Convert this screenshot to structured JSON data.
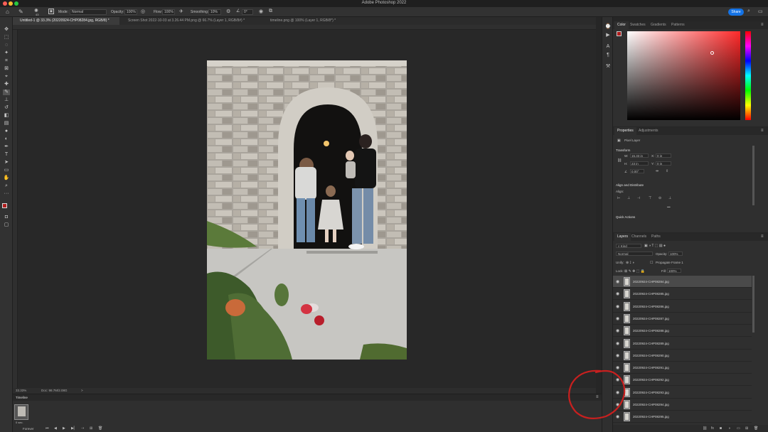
{
  "app": {
    "title": "Adobe Photoshop 2022"
  },
  "options_bar": {
    "mode_label": "Mode:",
    "mode_value": "Normal",
    "opacity_label": "Opacity:",
    "opacity_value": "100%",
    "flow_label": "Flow:",
    "flow_value": "100%",
    "smoothing_label": "Smoothing:",
    "smoothing_value": "10%",
    "angle_value": "0°",
    "brush_size": "43",
    "share_label": "Share"
  },
  "document_tabs": [
    {
      "label": "Untitled-1 @ 33.3% (20220924-CHP08284.jpg, RGB/8) *",
      "active": true
    },
    {
      "label": "Screen Shot 2022-10-03 at 3.26.44 PM.png @ 66.7% (Layer 1, RGB/8#) *",
      "active": false
    },
    {
      "label": "timeline.png @ 100% (Layer 1, RGB/8*) *",
      "active": false
    }
  ],
  "status": {
    "zoom": "33.33%",
    "doc": "Doc: 98.7M/2.08G",
    "arrow": ">"
  },
  "timeline": {
    "title": "Timeline",
    "frame_time": "0 sec.",
    "loop": "Forever"
  },
  "color_panel": {
    "tabs": [
      "Color",
      "Swatches",
      "Gradients",
      "Patterns"
    ],
    "active": "Color",
    "hue_color": "#ff2a2a"
  },
  "properties_panel": {
    "tabs": [
      "Properties",
      "Adjustments"
    ],
    "layer_type": "Pixel Layer",
    "transform_title": "Transform",
    "w_label": "W:",
    "w_value": "15.33 in",
    "h_label": "H:",
    "h_value": "23 in",
    "x_label": "X:",
    "x_value": "0 in",
    "y_label": "Y:",
    "y_value": "0 in",
    "angle_value": "0.00°",
    "align_title": "Align and Distribute",
    "align_label": "Align:",
    "more": "•••",
    "quick_actions_title": "Quick Actions"
  },
  "layers_panel": {
    "tabs": [
      "Layers",
      "Channels",
      "Paths"
    ],
    "filter_kind": "Kind",
    "blend_mode": "Normal",
    "opacity_label": "Opacity:",
    "opacity_value": "100%",
    "unify_label": "Unify:",
    "propagate_label": "Propagate Frame 1",
    "lock_label": "Lock:",
    "fill_label": "Fill:",
    "fill_value": "100%",
    "layers": [
      {
        "name": "20220924-CHP08284.jpg",
        "selected": true
      },
      {
        "name": "20220924-CHP08285.jpg",
        "selected": false
      },
      {
        "name": "20220924-CHP08286.jpg",
        "selected": false
      },
      {
        "name": "20220924-CHP08287.jpg",
        "selected": false
      },
      {
        "name": "20220924-CHP08288.jpg",
        "selected": false
      },
      {
        "name": "20220924-CHP08289.jpg",
        "selected": false
      },
      {
        "name": "20220924-CHP08290.jpg",
        "selected": false
      },
      {
        "name": "20220924-CHP08291.jpg",
        "selected": false
      },
      {
        "name": "20220924-CHP08292.jpg",
        "selected": false
      },
      {
        "name": "20220924-CHP08293.jpg",
        "selected": false
      },
      {
        "name": "20220924-CHP08294.jpg",
        "selected": false
      },
      {
        "name": "20220924-CHP08295.jpg",
        "selected": false
      }
    ]
  },
  "colors": {
    "accent": "#1473e6",
    "foreground": "#b01e1e",
    "background": "#ffffff",
    "annotation": "#c8201f"
  }
}
